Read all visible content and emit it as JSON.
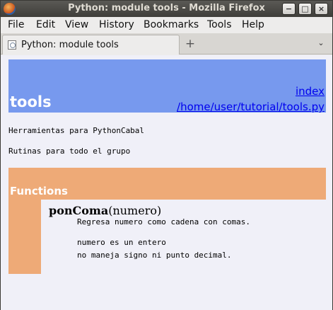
{
  "window": {
    "title": "Python: module tools - Mozilla Firefox",
    "controls": {
      "minimize": "−",
      "maximize": "□",
      "close": "×"
    }
  },
  "menubar": {
    "items": [
      "File",
      "Edit",
      "View",
      "History",
      "Bookmarks",
      "Tools",
      "Help"
    ]
  },
  "tabbar": {
    "tabs": [
      {
        "label": "Python: module tools"
      }
    ],
    "new_tab": "+",
    "dropdown": "⌄"
  },
  "page": {
    "module_title": "tools",
    "links": {
      "index": "index",
      "path": "/home/user/tutorial/tools.py"
    },
    "description": [
      "Herramientas para PythonCabal",
      "Rutinas para todo el grupo"
    ],
    "section_title": "Functions",
    "function": {
      "name": "ponComa",
      "args": "(numero)",
      "doc": [
        "Regresa numero como cadena con comas.",
        "numero es un entero",
        "no maneja signo ni punto decimal."
      ]
    }
  },
  "colors": {
    "heading_bg": "#7799ee",
    "section_bg": "#eeaa77",
    "page_bg": "#f0f0f8",
    "link": "#0000ee"
  }
}
